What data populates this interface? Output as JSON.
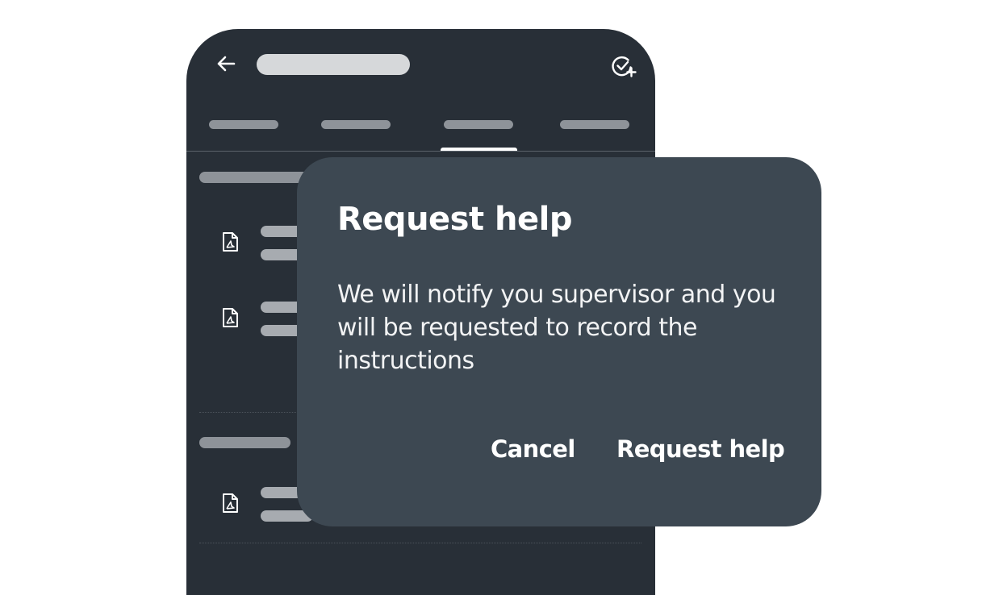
{
  "dialog": {
    "title": "Request help",
    "message": "We will notify you supervisor and you will be requested to record the instructions",
    "cancel_label": "Cancel",
    "confirm_label": "Request help"
  },
  "header": {
    "back_icon": "arrow-left-icon",
    "action_icon": "task-add-icon"
  },
  "tabs": {
    "count": 4,
    "selected_index": 2
  },
  "list": {
    "item_icon": "pdf-file-icon"
  },
  "colors": {
    "phone_background": "#282f37",
    "dialog_background": "#3d4852",
    "skeleton_light": "#d6d8da",
    "skeleton_mid": "#8e9399",
    "text": "#ffffff"
  }
}
